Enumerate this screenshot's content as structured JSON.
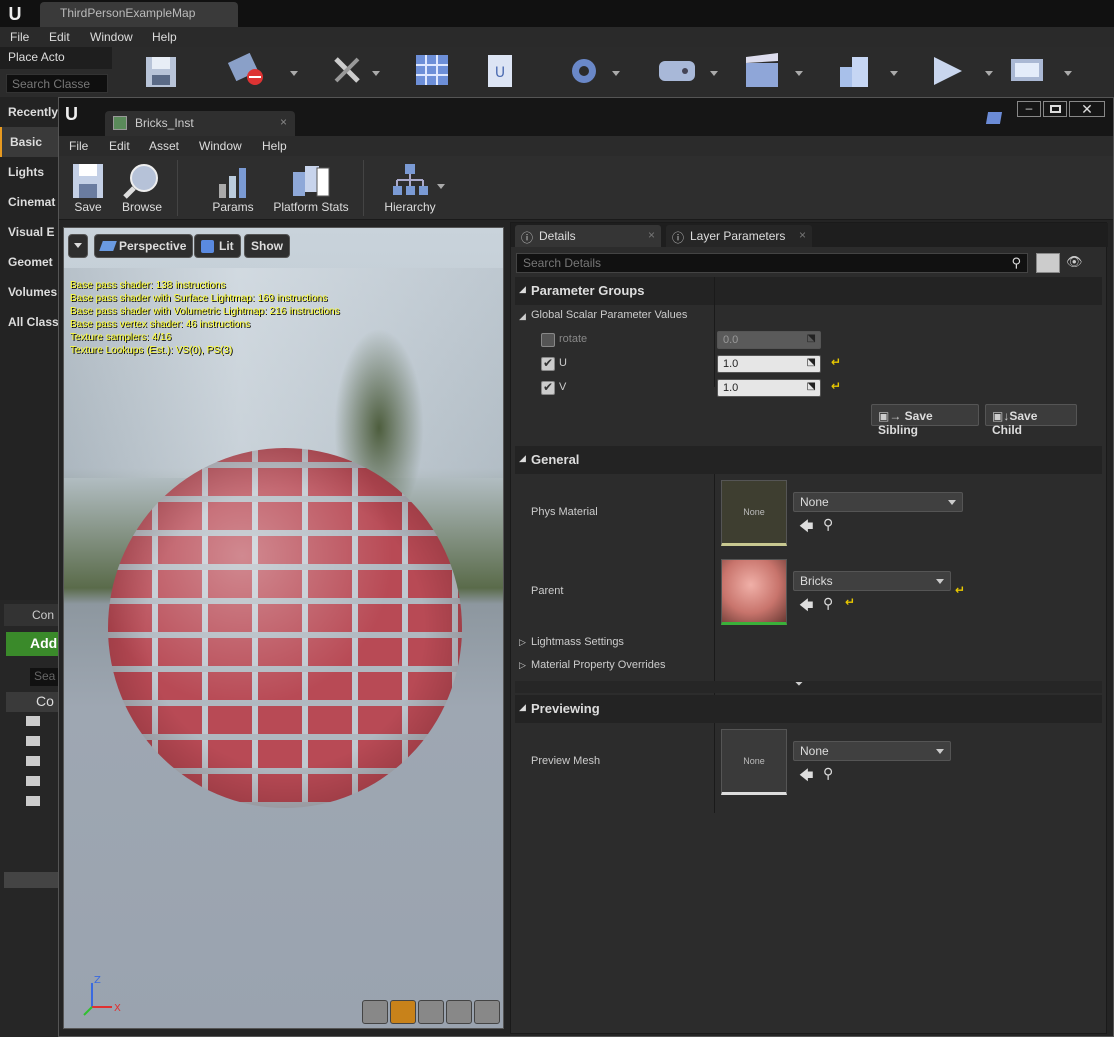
{
  "main": {
    "tab_title": "ThirdPersonExampleMap",
    "menu": [
      "File",
      "Edit",
      "Window",
      "Help"
    ],
    "place_actors": "Place Acto",
    "search_classes_placeholder": "Search Classe",
    "categories": [
      "Recently",
      "Basic",
      "Lights",
      "Cinemat",
      "Visual E",
      "Geomet",
      "Volumes",
      "All Class"
    ],
    "content_label": "Con",
    "add_label": "Add",
    "search_short": "Sea",
    "root_folder": "Co"
  },
  "editor": {
    "tab_title": "Bricks_Inst",
    "menu": [
      "File",
      "Edit",
      "Asset",
      "Window",
      "Help"
    ],
    "toolbar": {
      "save": "Save",
      "browse": "Browse",
      "params": "Params",
      "platform_stats": "Platform Stats",
      "hierarchy": "Hierarchy"
    }
  },
  "viewport": {
    "perspective": "Perspective",
    "lit": "Lit",
    "show": "Show",
    "stats": [
      "Base pass shader: 138 instructions",
      "Base pass shader with Surface Lightmap: 169 instructions",
      "Base pass shader with Volumetric Lightmap: 216 instructions",
      "Base pass vertex shader: 46 instructions",
      "Texture samplers: 4/16",
      "Texture Lookups (Est.): VS(0), PS(3)"
    ],
    "axis": {
      "z": "Z",
      "x": "X"
    }
  },
  "details": {
    "tabs": [
      "Details",
      "Layer Parameters"
    ],
    "search_placeholder": "Search Details",
    "parameter_groups": "Parameter Groups",
    "global_scalar": "Global Scalar Parameter Values",
    "params": [
      {
        "name": "rotate",
        "value": "0.0",
        "checked": false
      },
      {
        "name": "U",
        "value": "1.0",
        "checked": true
      },
      {
        "name": "V",
        "value": "1.0",
        "checked": true
      }
    ],
    "save_sibling": "Save Sibling",
    "save_child": "Save Child",
    "general": "General",
    "phys_material_label": "Phys Material",
    "phys_material_thumb": "None",
    "phys_material_value": "None",
    "parent_label": "Parent",
    "parent_value": "Bricks",
    "lightmass_settings": "Lightmass Settings",
    "material_property_overrides": "Material Property Overrides",
    "previewing": "Previewing",
    "preview_mesh_label": "Preview Mesh",
    "preview_mesh_thumb": "None",
    "preview_mesh_value": "None"
  }
}
